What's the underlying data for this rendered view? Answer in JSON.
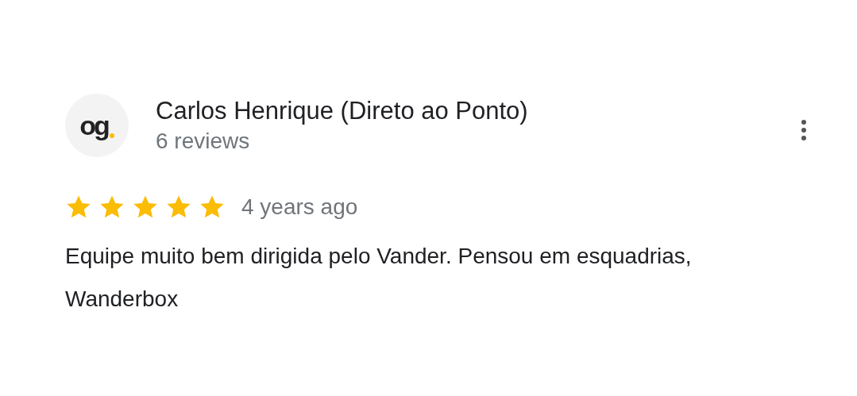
{
  "review": {
    "avatar": {
      "letters": "og"
    },
    "author": "Carlos Henrique (Direto ao Ponto)",
    "review_count": "6 reviews",
    "stars": 5,
    "time": "4 years ago",
    "text": "Equipe muito bem dirigida pelo Vander. Pensou em esquadrias, Wanderbox"
  }
}
